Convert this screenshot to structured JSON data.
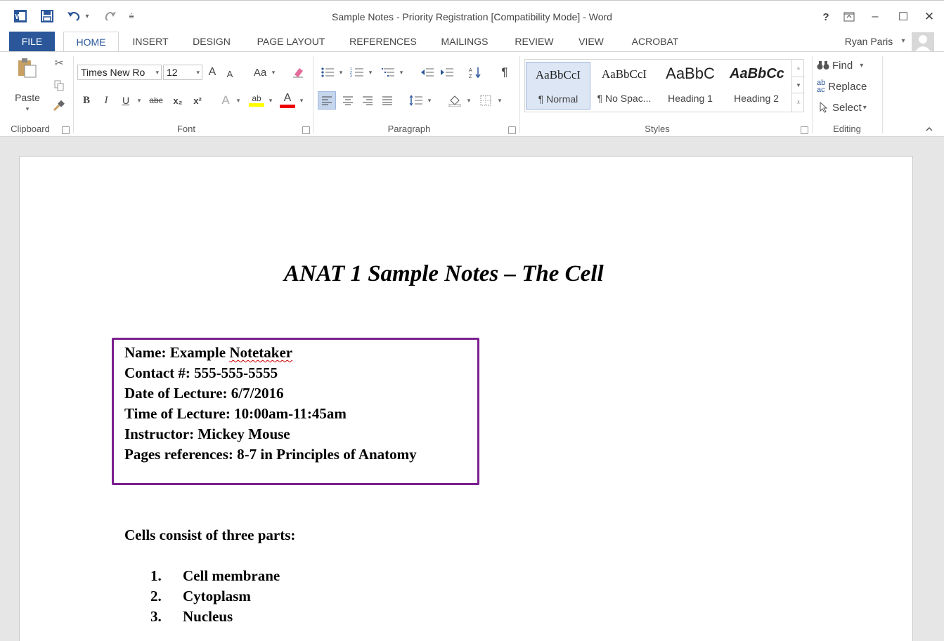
{
  "window": {
    "title": "Sample Notes - Priority Registration [Compatibility Mode] - Word",
    "help": "?",
    "ribbon_display": "⊼",
    "minimize": "–",
    "maximize": "☐",
    "close": "✕"
  },
  "tabs": {
    "file": "FILE",
    "home": "HOME",
    "insert": "INSERT",
    "design": "DESIGN",
    "page_layout": "PAGE LAYOUT",
    "references": "REFERENCES",
    "mailings": "MAILINGS",
    "review": "REVIEW",
    "view": "VIEW",
    "acrobat": "ACROBAT"
  },
  "user": {
    "name": "Ryan Paris",
    "caret": "▾"
  },
  "ribbon": {
    "clipboard": {
      "paste": "Paste",
      "label": "Clipboard"
    },
    "font": {
      "family": "Times New Ro",
      "size": "12",
      "grow": "A",
      "shrink": "A",
      "change_case": "Aa",
      "bold": "B",
      "italic": "I",
      "underline": "U",
      "strike": "abc",
      "subscript": "x₂",
      "superscript": "x²",
      "text_effects": "A",
      "highlight": "ab",
      "font_color": "A",
      "label": "Font"
    },
    "paragraph": {
      "label": "Paragraph",
      "pilcrow": "¶"
    },
    "styles": {
      "label": "Styles",
      "items": [
        {
          "preview": "AaBbCcI",
          "name": "¶ Normal"
        },
        {
          "preview": "AaBbCcI",
          "name": "¶ No Spac..."
        },
        {
          "preview": "AaBbC",
          "name": "Heading 1"
        },
        {
          "preview": "AaBbCc",
          "name": "Heading 2"
        }
      ]
    },
    "editing": {
      "find": "Find",
      "replace": "Replace",
      "select": "Select",
      "label": "Editing"
    }
  },
  "document": {
    "title": "ANAT 1 Sample Notes – The Cell",
    "info": {
      "name_prefix": "Name: Example ",
      "name_misspelled": "Notetaker",
      "contact": "Contact #: 555-555-5555",
      "date": "Date of Lecture: 6/7/2016",
      "time": "Time of Lecture: 10:00am-11:45am",
      "instructor": "Instructor: Mickey Mouse",
      "pages": "Pages references: 8-7 in Principles of Anatomy"
    },
    "intro": "Cells consist of three parts:",
    "list": [
      {
        "num": "1.",
        "text": "Cell membrane"
      },
      {
        "num": "2.",
        "text": "Cytoplasm"
      },
      {
        "num": "3.",
        "text": "Nucleus"
      }
    ]
  },
  "colors": {
    "word_blue": "#2b579a",
    "box_border": "#7b1f8f"
  }
}
